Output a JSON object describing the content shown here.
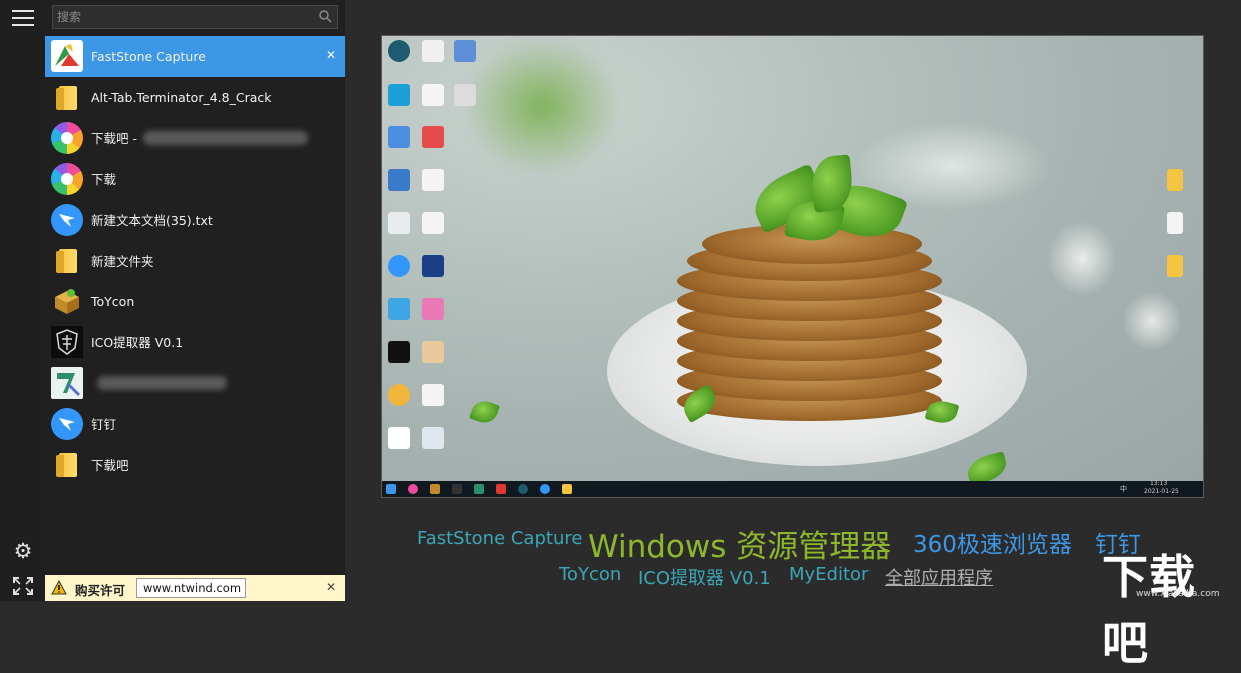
{
  "search": {
    "placeholder": "搜索"
  },
  "list": [
    {
      "label": "FastStone Capture",
      "icon": "faststone-icon",
      "active": true
    },
    {
      "label": "Alt-Tab.Terminator_4.8_Crack",
      "icon": "folder-icon"
    },
    {
      "label": "下载吧 -",
      "icon": "chrome-like-icon",
      "blurred": true
    },
    {
      "label": "下载",
      "icon": "chrome-like-icon"
    },
    {
      "label": "新建文本文档(35).txt",
      "icon": "dingtalk-icon"
    },
    {
      "label": "新建文件夹",
      "icon": "folder-icon"
    },
    {
      "label": "ToYcon",
      "icon": "toycon-icon"
    },
    {
      "label": "ICO提取器 V0.1",
      "icon": "ico-extractor-icon"
    },
    {
      "label": "",
      "icon": "rapidtyping-icon",
      "blurred": true
    },
    {
      "label": "钉钉",
      "icon": "dingtalk-icon"
    },
    {
      "label": "下载吧",
      "icon": "folder-icon"
    }
  ],
  "notice": {
    "buy_label": "购买许可",
    "url": "www.ntwind.com"
  },
  "preview": {
    "taskbar_time": "13:13",
    "taskbar_date": "2021-01-25",
    "taskbar_lang": "中"
  },
  "apps": [
    {
      "label": "FastStone Capture",
      "color": "#3aa6b6",
      "size": 18
    },
    {
      "label": "Windows 资源管理器",
      "color": "#8db82c",
      "size": 31
    },
    {
      "label": "360极速浏览器",
      "color": "#3c97e6",
      "size": 23
    },
    {
      "label": "钉钉",
      "color": "#3c97e6",
      "size": 23
    },
    {
      "label": "ToYcon",
      "color": "#3aa6b6",
      "size": 18
    },
    {
      "label": "ICO提取器 V0.1",
      "color": "#3aa6b6",
      "size": 18
    },
    {
      "label": "MyEditor",
      "color": "#3aa6b6",
      "size": 18
    },
    {
      "label": "全部应用程序",
      "color": "#b0b0b0",
      "size": 18
    }
  ],
  "watermark": {
    "big": "下载吧",
    "small": "www.xiazaiba.com"
  }
}
